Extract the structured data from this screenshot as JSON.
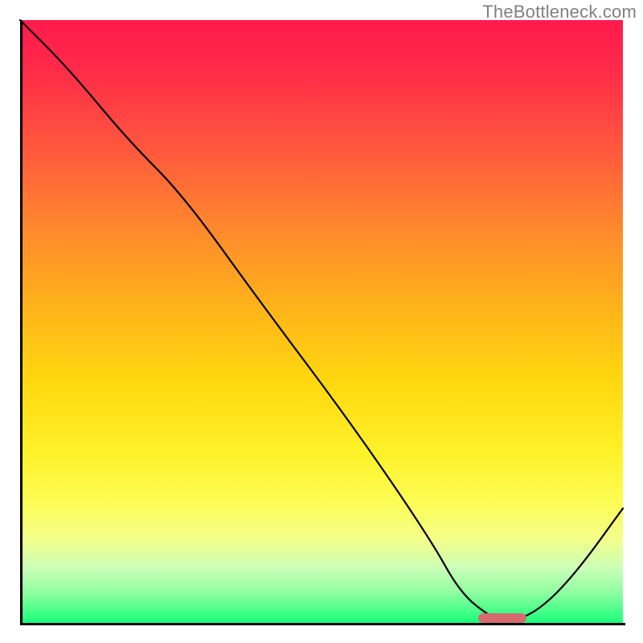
{
  "watermark": "TheBottleneck.com",
  "chart_data": {
    "type": "line",
    "title": "",
    "xlabel": "",
    "ylabel": "",
    "xlim": [
      0,
      100
    ],
    "ylim": [
      0,
      100
    ],
    "grid": false,
    "legend": false,
    "background_gradient_stops": [
      {
        "pos": 0.0,
        "color": "#ff1a4d"
      },
      {
        "pos": 0.35,
        "color": "#ff8a2c"
      },
      {
        "pos": 0.6,
        "color": "#ffd80f"
      },
      {
        "pos": 0.8,
        "color": "#fdfd55"
      },
      {
        "pos": 0.95,
        "color": "#8effa0"
      },
      {
        "pos": 1.0,
        "color": "#19ff7a"
      }
    ],
    "series": [
      {
        "name": "bottleneck-curve",
        "x": [
          0,
          8,
          18,
          27,
          40,
          55,
          68,
          73,
          78,
          81,
          86,
          92,
          100
        ],
        "y": [
          100,
          92,
          80,
          71,
          53,
          33,
          14,
          5,
          1,
          0,
          2,
          8,
          19
        ]
      }
    ],
    "marker": {
      "name": "optimal-range",
      "shape": "pill",
      "x_start": 76,
      "x_end": 84,
      "y": 0.8,
      "color": "#d66a6c"
    }
  }
}
